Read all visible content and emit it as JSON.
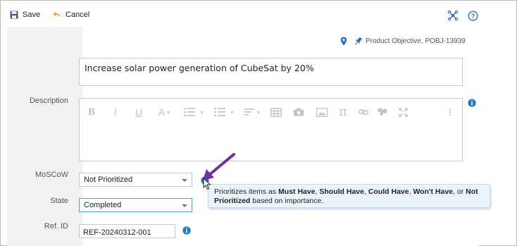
{
  "toolbar": {
    "save_label": "Save",
    "cancel_label": "Cancel",
    "icons": [
      "save-icon",
      "undo-icon",
      "hierarchy-icon",
      "help-icon"
    ]
  },
  "item": {
    "owner_text": "Product Objective, POBJ-13939",
    "title": "Increase solar power generation of CubeSat by 20%"
  },
  "fields": {
    "description_label": "Description",
    "moscow_label": "MoSCoW",
    "moscow_value": "Not Prioritized",
    "state_label": "State",
    "state_value": "Completed",
    "ref_label": "Ref. ID",
    "ref_value": "REF-20240312-001"
  },
  "editor_toolbar": [
    "bold",
    "italic",
    "underline",
    "font-size",
    "ordered-list",
    "unordered-list",
    "align",
    "table",
    "camera",
    "image",
    "formula",
    "link",
    "special-characters",
    "fullscreen",
    "more"
  ],
  "tooltip": {
    "prefix": "Prioritizes items as ",
    "must": "Must Have",
    "sep1": ", ",
    "should": "Should Have",
    "sep2": ", ",
    "could": "Could Have",
    "sep3": ", ",
    "wont": "Won't Have",
    "sep4": ", or ",
    "not_prioritized": "Not Prioritized",
    "suffix": " based on importance."
  },
  "colors": {
    "accent_blue": "#2e6fb6",
    "info_blue": "#1f7ac4",
    "annotation_purple": "#7030a0",
    "tooltip_bg": "#eaf4fb"
  }
}
